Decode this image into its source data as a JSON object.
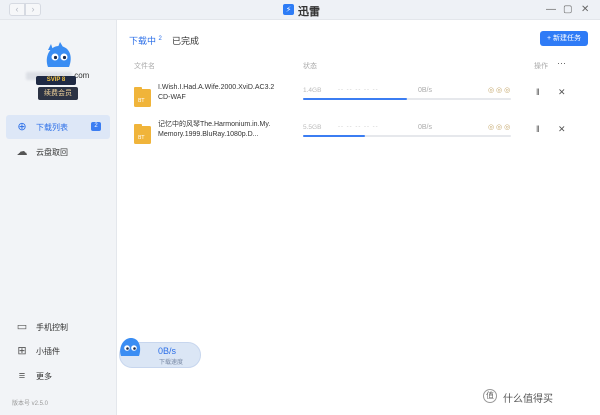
{
  "window": {
    "title": "迅雷",
    "logo_glyph": "⚡",
    "back_glyph": "‹",
    "forward_glyph": "›",
    "minimize_glyph": "—",
    "restore_glyph": "▢",
    "close_glyph": "✕"
  },
  "user": {
    "email_suffix": ".com",
    "vip_label": "SVIP 8",
    "renew_label": "续费会员"
  },
  "sidebar": {
    "items": [
      {
        "label": "下载列表",
        "icon": "download-circle-icon",
        "glyph": "⊕",
        "badge": "2"
      },
      {
        "label": "云盘取回",
        "icon": "cloud-icon",
        "glyph": "☁"
      },
      {
        "label": "手机控制",
        "icon": "phone-screen-icon",
        "glyph": "▭"
      },
      {
        "label": "小插件",
        "icon": "grid-plugin-icon",
        "glyph": "⊞"
      },
      {
        "label": "更多",
        "icon": "menu-icon",
        "glyph": "≡"
      }
    ],
    "version": "版本号 v2.5.0"
  },
  "tabs": {
    "downloading": "下载中",
    "downloading_count": "2",
    "done": "已完成"
  },
  "toolbar": {
    "new_task": "+ 新建任务",
    "more_glyph": "···"
  },
  "columns": {
    "name": "文件名",
    "status": "状态",
    "ops": "操作"
  },
  "rows": [
    {
      "name": "I.Wish.I.Had.A.Wife.2000.XviD.AC3.2CD-WAF",
      "size": "1.4GB",
      "dash": "-- -- -- -- --",
      "speed": "0B/s",
      "icons": "◎ ◎ ◎",
      "progress": 0.5,
      "pause_glyph": "‖",
      "close_glyph": "✕"
    },
    {
      "name": "记忆中的风琴The.Harmonium.in.My.Memory.1999.BluRay.1080p.D...",
      "size": "5.5GB",
      "dash": "-- -- -- -- --",
      "speed": "0B/s",
      "icons": "◎ ◎ ◎",
      "progress": 0.3,
      "pause_glyph": "‖",
      "close_glyph": "✕"
    }
  ],
  "speed_widget": {
    "value": "0B/s",
    "label": "下载速度"
  },
  "watermark": {
    "logo": "值",
    "text": "什么值得买"
  },
  "colors": {
    "accent": "#2f7bf6",
    "sidebar_bg": "#f2f4f7",
    "folder": "#f0b43a"
  }
}
